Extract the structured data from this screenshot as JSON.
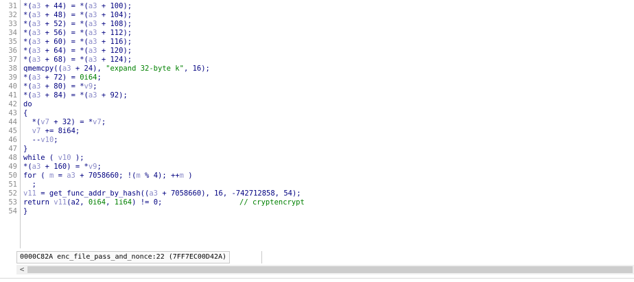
{
  "gutter": {
    "line_numbers": [
      "31",
      "32",
      "33",
      "34",
      "35",
      "36",
      "37",
      "38",
      "39",
      "40",
      "41",
      "42",
      "43",
      "44",
      "45",
      "46",
      "47",
      "48",
      "49",
      "50",
      "51",
      "52",
      "53",
      "54"
    ]
  },
  "code": {
    "l31": {
      "a": "*(",
      "b": "a3",
      "c": " + 44) = *(",
      "d": "a3",
      "e": " + 100);"
    },
    "l32": {
      "a": "*(",
      "b": "a3",
      "c": " + 48) = *(",
      "d": "a3",
      "e": " + 104);"
    },
    "l33": {
      "a": "*(",
      "b": "a3",
      "c": " + 52) = *(",
      "d": "a3",
      "e": " + 108);"
    },
    "l34": {
      "a": "*(",
      "b": "a3",
      "c": " + 56) = *(",
      "d": "a3",
      "e": " + 112);"
    },
    "l35": {
      "a": "*(",
      "b": "a3",
      "c": " + 60) = *(",
      "d": "a3",
      "e": " + 116);"
    },
    "l36": {
      "a": "*(",
      "b": "a3",
      "c": " + 64) = *(",
      "d": "a3",
      "e": " + 120);"
    },
    "l37": {
      "a": "*(",
      "b": "a3",
      "c": " + 68) = *(",
      "d": "a3",
      "e": " + 124);"
    },
    "l38": {
      "a": "qmemcpy((",
      "b": "a3",
      "c": " + 24), ",
      "s": "\"expand 32-byte k\"",
      "e": ", 16);"
    },
    "l39": {
      "a": "*(",
      "b": "a3",
      "c": " + 72) = ",
      "n": "0i64",
      "e": ";"
    },
    "l40": {
      "a": "*(",
      "b": "a3",
      "c": " + 80) = *",
      "d": "v9",
      "e": ";"
    },
    "l41": {
      "a": "*(",
      "b": "a3",
      "c": " + 84) = *(",
      "d": "a3",
      "e": " + 92);"
    },
    "l42": {
      "a": "do"
    },
    "l43": {
      "a": "{"
    },
    "l44": {
      "a": "  *(",
      "b": "v7",
      "c": " + 32) = *",
      "d": "v7",
      "e": ";"
    },
    "l45": {
      "a": "  ",
      "b": "v7",
      "c": " += 8i64;"
    },
    "l46": {
      "a": "  --",
      "b": "v10",
      "c": ";"
    },
    "l47": {
      "a": "}"
    },
    "l48": {
      "a": "while ( ",
      "b": "v10",
      "c": " );"
    },
    "l49": {
      "a": "*(",
      "b": "a3",
      "c": " + 160) = *",
      "d": "v9",
      "e": ";"
    },
    "l50": {
      "a": "for ( ",
      "b": "m",
      "c": " = ",
      "d": "a3",
      "e": " + 7058660; !(",
      "f": "m",
      "g": " % 4); ++",
      "h": "m",
      "i": " )"
    },
    "l51": {
      "a": "  ;"
    },
    "l52": {
      "a": "",
      "b": "v11",
      "c": " = get_func_addr_by_hash((",
      "d": "a3",
      "e": " + 7058660), 16, -742712858, 54);"
    },
    "l53": {
      "a": "return ",
      "b": "v11",
      "c": "(a2, ",
      "n1": "0i64",
      "m": ", ",
      "n2": "1i64",
      "e": ") != 0;",
      "com": "// cryptencrypt"
    },
    "l54": {
      "a": "}"
    }
  },
  "status": {
    "text": "0000C82A enc_file_pass_and_nonce:22 (7FF7EC00D42A)"
  },
  "scrollbar": {
    "left_arrow": "<"
  }
}
